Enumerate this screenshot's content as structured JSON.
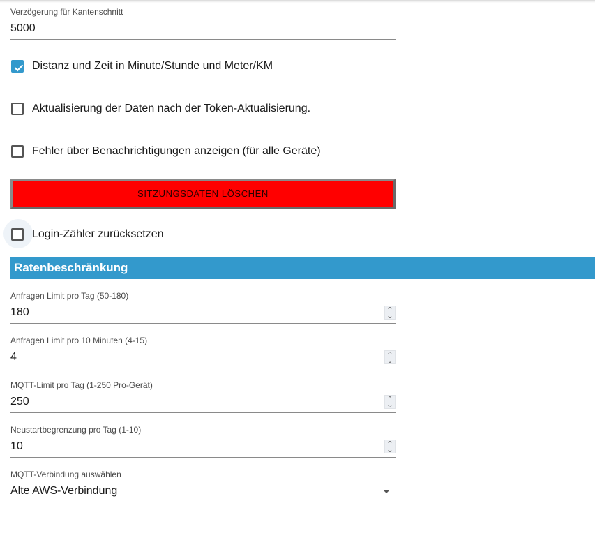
{
  "fields": {
    "edge_delay": {
      "label": "Verzögerung für Kantenschnitt",
      "value": "5000"
    },
    "req_per_day": {
      "label": "Anfragen Limit pro Tag (50-180)",
      "value": "180"
    },
    "req_per_10min": {
      "label": "Anfragen Limit pro 10 Minuten (4-15)",
      "value": "4"
    },
    "mqtt_per_day": {
      "label": "MQTT-Limit pro Tag (1-250 Pro-Gerät)",
      "value": "250"
    },
    "restart_per_day": {
      "label": "Neustartbegrenzung pro Tag (1-10)",
      "value": "10"
    },
    "mqtt_connection": {
      "label": "MQTT-Verbindung auswählen",
      "value": "Alte AWS-Verbindung"
    }
  },
  "checkboxes": {
    "distance_units": {
      "label": "Distanz und Zeit in Minute/Stunde und Meter/KM",
      "checked": true
    },
    "refresh_after_token": {
      "label": "Aktualisierung der Daten nach der Token-Aktualisierung.",
      "checked": false
    },
    "errors_notifications": {
      "label": "Fehler über Benachrichtigungen anzeigen (für alle Geräte)",
      "checked": false
    },
    "reset_login_counter": {
      "label": "Login-Zähler zurücksetzen",
      "checked": false
    }
  },
  "buttons": {
    "clear_session": "SITZUNGSDATEN LÖSCHEN"
  },
  "sections": {
    "rate_limit": "Ratenbeschränkung"
  },
  "icons": {
    "stepper": "spin-stepper-icon",
    "dropdown": "dropdown-caret-icon",
    "check": "checkmark-icon"
  },
  "colors": {
    "accent": "#3399cc",
    "danger": "#ff0000"
  }
}
